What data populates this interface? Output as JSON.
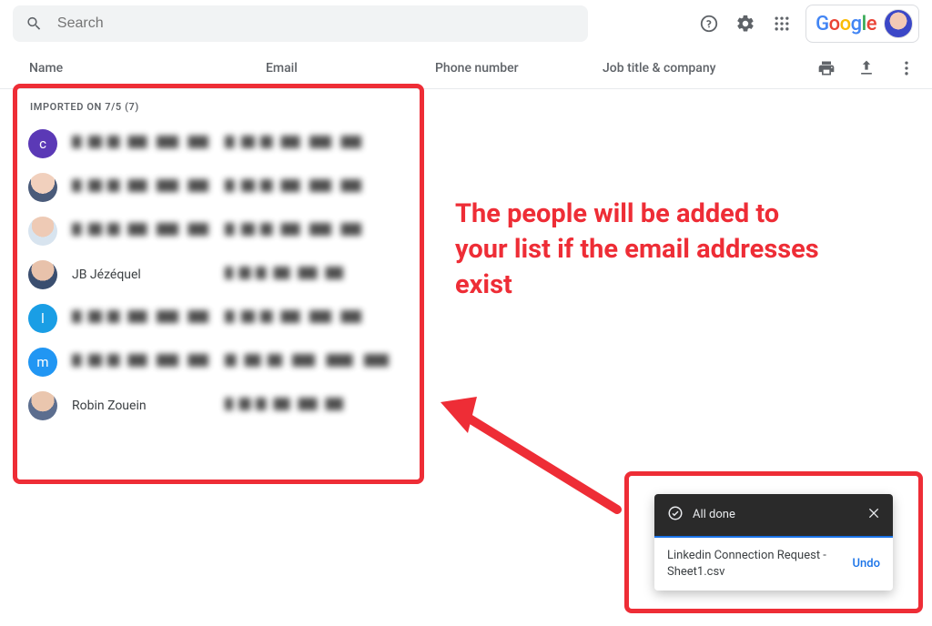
{
  "search": {
    "placeholder": "Search"
  },
  "columns": {
    "name": "Name",
    "email": "Email",
    "phone": "Phone number",
    "job": "Job title & company"
  },
  "importedLabel": "IMPORTED ON 7/5 (7)",
  "contacts": [
    {
      "avatarLetter": "c",
      "avatarClass": "av-purple",
      "name": "",
      "blurred": true
    },
    {
      "avatarLetter": "",
      "avatarClass": "av-photo",
      "name": "",
      "blurred": true
    },
    {
      "avatarLetter": "",
      "avatarClass": "av-photo2",
      "name": "",
      "blurred": true
    },
    {
      "avatarLetter": "",
      "avatarClass": "av-photo3",
      "name": "JB Jézéquel",
      "blurred": false
    },
    {
      "avatarLetter": "l",
      "avatarClass": "av-blue",
      "name": "",
      "blurred": true
    },
    {
      "avatarLetter": "m",
      "avatarClass": "av-blue2",
      "name": "",
      "blurred": true
    },
    {
      "avatarLetter": "",
      "avatarClass": "av-photo4",
      "name": "Robin Zouein",
      "blurred": false
    }
  ],
  "annotation": "The people will be added to your list if the email addresses exist",
  "toast": {
    "title": "All done",
    "file": "Linkedin Connection Request - Sheet1.csv",
    "undo": "Undo"
  },
  "logo": {
    "g": "G",
    "o1": "o",
    "o2": "o",
    "g2": "g",
    "l": "l",
    "e": "e"
  }
}
